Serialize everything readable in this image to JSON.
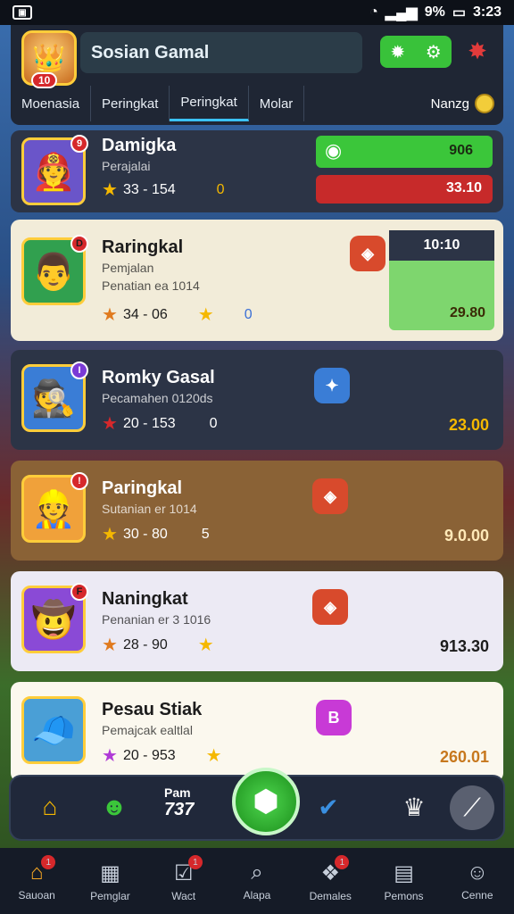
{
  "status": {
    "time": "3:23",
    "battery": "9%"
  },
  "header": {
    "title": "Sosian Gamal",
    "level": "10",
    "tabs": [
      "Moenasia",
      "Peringkat",
      "Peringkat",
      "Molar"
    ],
    "right_label": "Nanzg",
    "colors": {
      "accent": "#3bc2ff",
      "gold": "#f2cd3a",
      "danger": "#d6282b"
    }
  },
  "list": [
    {
      "name": "Damigka",
      "sub": "Perajalai",
      "stat": "33 - 154",
      "stat2": "0",
      "score_top": "906",
      "score_bottom": "33.10"
    },
    {
      "name": "Raringkal",
      "sub": "Pemjalan",
      "sub2": "Penatian ea 1014",
      "stat": "34 - 06",
      "stat2": "0",
      "score_top": "10:10",
      "score_bottom": "29.80"
    },
    {
      "name": "Romky Gasal",
      "sub": "Pecamahen 0120ds",
      "stat": "20 - 153",
      "stat2": "0",
      "score": "23.00"
    },
    {
      "name": "Paringkal",
      "sub": "Sutanian er 1014",
      "stat": "30 - 80",
      "stat2": "5",
      "score": "9.0.00"
    },
    {
      "name": "Naningkat",
      "sub": "Penanian er 3 1016",
      "stat": "28 - 90",
      "score": "913.30"
    },
    {
      "name": "Pesau Stiak",
      "sub": "Pemajcak ealtlal",
      "stat": "20 - 953",
      "score": "260.01"
    }
  ],
  "dock": {
    "center_label": "Pam",
    "center_value": "737"
  },
  "nav": [
    {
      "label": "Sauoan",
      "icon": "home-icon"
    },
    {
      "label": "Pemglar",
      "icon": "chart-icon"
    },
    {
      "label": "Wact",
      "icon": "check-icon"
    },
    {
      "label": "Alapa",
      "icon": "search-icon"
    },
    {
      "label": "Demales",
      "icon": "gift-icon"
    },
    {
      "label": "Pemons",
      "icon": "calendar-icon"
    },
    {
      "label": "Cenne",
      "icon": "user-icon"
    }
  ]
}
